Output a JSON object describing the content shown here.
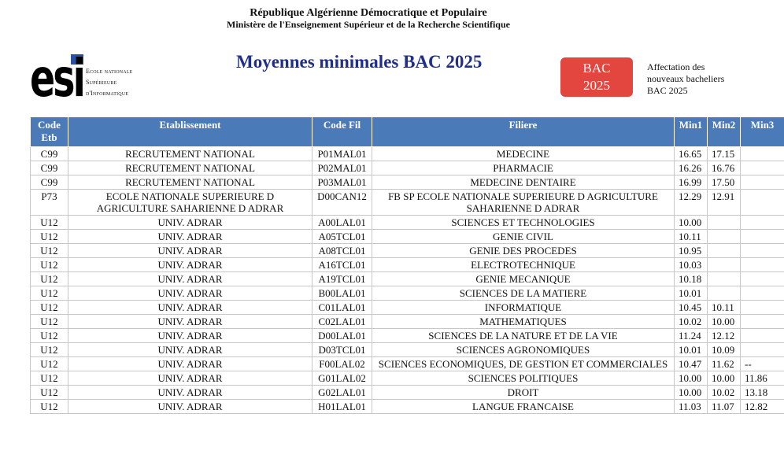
{
  "header": {
    "line1": "République Algérienne Démocratique et Populaire",
    "line2": "Ministère de l'Enseignement Supérieur et de la Recherche Scientifique"
  },
  "logo": {
    "mark": "esi",
    "line1": "Ecole nationale",
    "line2": "Supérieure",
    "line3": "d'Informatique"
  },
  "title": "Moyennes minimales BAC 2025",
  "badge": {
    "line1": "BAC",
    "line2": "2025",
    "color": "#e2463f"
  },
  "affectation": {
    "line1": "Affectation des",
    "line2": "nouveaux bacheliers",
    "line3": "BAC 2025"
  },
  "table": {
    "header_color": "#4a7ab8",
    "columns": [
      "Code Etb",
      "Etablissement",
      "Code Fil",
      "Filiere",
      "Min1",
      "Min2",
      "Min3"
    ],
    "rows": [
      [
        "C99",
        "RECRUTEMENT NATIONAL",
        "P01MAL01",
        "MEDECINE",
        "16.65",
        "17.15",
        ""
      ],
      [
        "C99",
        "RECRUTEMENT NATIONAL",
        "P02MAL01",
        "PHARMACIE",
        "16.26",
        "16.76",
        ""
      ],
      [
        "C99",
        "RECRUTEMENT NATIONAL",
        "P03MAL01",
        "MEDECINE DENTAIRE",
        "16.99",
        "17.50",
        ""
      ],
      [
        "P73",
        "ECOLE NATIONALE SUPERIEURE D AGRICULTURE SAHARIENNE D ADRAR",
        "D00CAN12",
        "FB SP ECOLE NATIONALE SUPERIEURE D AGRICULTURE SAHARIENNE D ADRAR",
        "12.29",
        "12.91",
        ""
      ],
      [
        "U12",
        "UNIV. ADRAR",
        "A00LAL01",
        "SCIENCES ET TECHNOLOGIES",
        "10.00",
        "",
        ""
      ],
      [
        "U12",
        "UNIV. ADRAR",
        "A05TCL01",
        "GENIE CIVIL",
        "10.11",
        "",
        ""
      ],
      [
        "U12",
        "UNIV. ADRAR",
        "A08TCL01",
        "GENIE DES PROCEDES",
        "10.95",
        "",
        ""
      ],
      [
        "U12",
        "UNIV. ADRAR",
        "A16TCL01",
        "ELECTROTECHNIQUE",
        "10.03",
        "",
        ""
      ],
      [
        "U12",
        "UNIV. ADRAR",
        "A19TCL01",
        "GENIE MECANIQUE",
        "10.18",
        "",
        ""
      ],
      [
        "U12",
        "UNIV. ADRAR",
        "B00LAL01",
        "SCIENCES DE LA MATIERE",
        "10.01",
        "",
        ""
      ],
      [
        "U12",
        "UNIV. ADRAR",
        "C01LAL01",
        "INFORMATIQUE",
        "10.45",
        "10.11",
        ""
      ],
      [
        "U12",
        "UNIV. ADRAR",
        "C02LAL01",
        "MATHEMATIQUES",
        "10.02",
        "10.00",
        ""
      ],
      [
        "U12",
        "UNIV. ADRAR",
        "D00LAL01",
        "SCIENCES DE LA NATURE ET DE LA VIE",
        "11.24",
        "12.12",
        ""
      ],
      [
        "U12",
        "UNIV. ADRAR",
        "D03TCL01",
        "SCIENCES AGRONOMIQUES",
        "10.01",
        "10.09",
        ""
      ],
      [
        "U12",
        "UNIV. ADRAR",
        "F00LAL02",
        "SCIENCES ECONOMIQUES, DE GESTION ET COMMERCIALES",
        "10.47",
        "11.62",
        "--"
      ],
      [
        "U12",
        "UNIV. ADRAR",
        "G01LAL02",
        "SCIENCES POLITIQUES",
        "10.00",
        "10.00",
        "11.86"
      ],
      [
        "U12",
        "UNIV. ADRAR",
        "G02LAL01",
        "DROIT",
        "10.00",
        "10.02",
        "13.18"
      ],
      [
        "U12",
        "UNIV. ADRAR",
        "H01LAL01",
        "LANGUE FRANCAISE",
        "11.03",
        "11.07",
        "12.82"
      ]
    ]
  }
}
